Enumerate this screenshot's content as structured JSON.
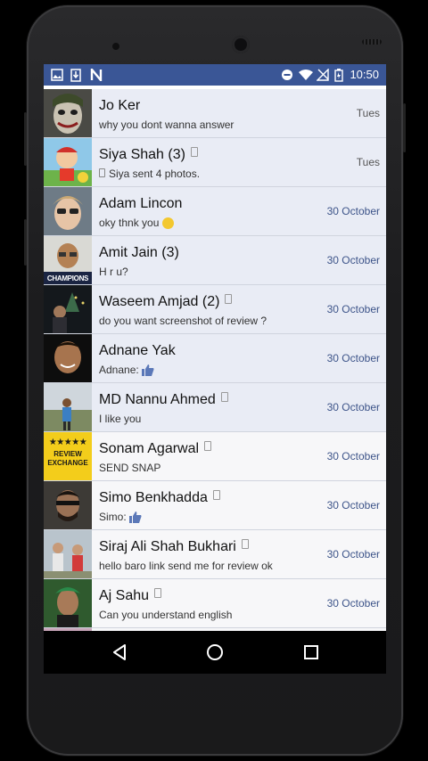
{
  "status_bar": {
    "time": "10:50",
    "left_icons": [
      "image-icon",
      "download-icon",
      "n-app-icon"
    ],
    "right_icons": [
      "do-not-disturb-icon",
      "wifi-icon",
      "signal-icon",
      "battery-icon"
    ]
  },
  "conversations": [
    {
      "name": "Jo Ker",
      "snippet": "why you dont wanna answer",
      "time": "Tues",
      "unread": true
    },
    {
      "name": "Siya Shah (3)",
      "snippet": "Siya sent 4 photos.",
      "time": "Tues",
      "unread": true
    },
    {
      "name": "Adam Lincon",
      "snippet": "oky thnk you",
      "time": "30 October",
      "unread": true
    },
    {
      "name": "Amit Jain (3)",
      "snippet": "H r u?",
      "time": "30 October",
      "unread": true
    },
    {
      "name": "Waseem Amjad (2)",
      "snippet": "do you want screenshot of review ?",
      "time": "30 October",
      "unread": true
    },
    {
      "name": "Adnane Yak",
      "snippet": "Adnane:",
      "time": "30 October",
      "unread": true
    },
    {
      "name": "MD Nannu Ahmed",
      "snippet": "I like you",
      "time": "30 October",
      "unread": true
    },
    {
      "name": "Sonam Agarwal",
      "snippet": "SEND SNAP",
      "time": "30 October",
      "unread": false
    },
    {
      "name": "Simo Benkhadda",
      "snippet": "Simo:",
      "time": "30 October",
      "unread": false
    },
    {
      "name": "Siraj Ali Shah Bukhari",
      "snippet": "hello baro link send me for review ok",
      "time": "30 October",
      "unread": false
    },
    {
      "name": "Aj Sahu",
      "snippet": "Can you understand english",
      "time": "30 October",
      "unread": false
    }
  ],
  "avatar_text": {
    "amit": "CHAMPIONS",
    "sonam_stars": "★★★★★",
    "sonam_line1": "REVIEW",
    "sonam_line2": "EXCHANGE"
  },
  "colors": {
    "status_bar": "#3a5696",
    "time_text": "#3d5489",
    "unread_bg": "#e9ecf5"
  }
}
